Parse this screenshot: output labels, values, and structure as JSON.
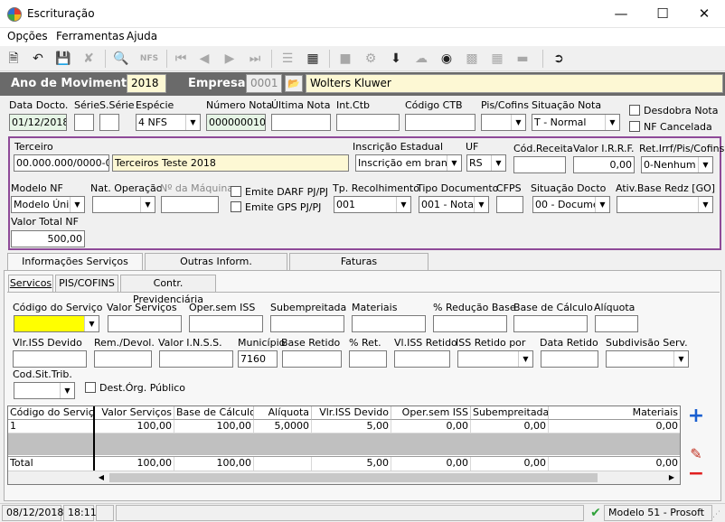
{
  "window": {
    "title": "Escrituração"
  },
  "menu": [
    "Opções",
    "Ferramentas",
    "Ajuda"
  ],
  "toolbar": {
    "nfs_label": "NFS"
  },
  "header": {
    "ano_label": "Ano de Movimento",
    "ano_value": "2018",
    "empresa_label": "Empresa",
    "empresa_code": "0001",
    "empresa_name": "Wolters Kluwer"
  },
  "doc": {
    "data_docto_label": "Data Docto.",
    "data_docto": "01/12/2018",
    "serie_label": "Série",
    "serie": "",
    "sserie_label": "S.Série",
    "sserie": "",
    "especie_label": "Espécie",
    "especie": "4 NFS",
    "numero_label": "Número Nota",
    "numero": "0000000100",
    "ultima_label": "Última Nota",
    "ultima": "",
    "intctb_label": "Int.Ctb",
    "intctb": "",
    "codctb_label": "Código CTB",
    "codctb": "",
    "piscofins_label": "Pis/Cofins",
    "piscofins": "",
    "situacao_label": "Situação Nota",
    "situacao": "T - Normal",
    "desdobra_label": "Desdobra Nota",
    "cancelada_label": "NF Cancelada"
  },
  "terceiro": {
    "label": "Terceiro",
    "cnpj": "00.000.000/0000-00",
    "nome": "Terceiros Teste 2018",
    "ie_label": "Inscrição Estadual",
    "ie": "Inscrição em branco",
    "uf_label": "UF",
    "uf": "RS",
    "codreceita_label": "Cód.Receita",
    "codreceita": "",
    "irrf_label": "Valor I.R.R.F.",
    "irrf": "0,00",
    "retirrf_label": "Ret.Irrf/Pis/Cofins",
    "retirrf": "0-Nenhum",
    "modelo_label": "Modelo NF",
    "modelo": "Modelo Únic",
    "natop_label": "Nat. Operação",
    "natop": "",
    "maquina_label": "Nº da Máquina",
    "maquina": "",
    "darf_label": "Emite DARF PJ/PJ",
    "gps_label": "Emite GPS PJ/PJ",
    "tprecol_label": "Tp. Recolhimento",
    "tprecol": "001",
    "tipodoc_label": "Tipo Documento",
    "tipodoc": "001 - Nota F",
    "cfps_label": "CFPS",
    "cfps": "",
    "sitdocto_label": "Situação Docto",
    "sitdocto": "00 - Documen",
    "ativbase_label": "Ativ.Base Redz [GO]",
    "ativbase": "",
    "vtotal_label": "Valor Total NF",
    "vtotal": "500,00"
  },
  "tabs_main": [
    "Informações Serviços",
    "Outras Inform.",
    "Faturas"
  ],
  "tabs_sub": [
    "Servicos",
    "PIS/COFINS",
    "Contr. Previdenciária"
  ],
  "serv": {
    "codserv_label": "Código do Serviço",
    "codserv": "",
    "valserv_label": "Valor Serviços",
    "valserv": "",
    "opersem_label": "Oper.sem ISS",
    "opersem": "",
    "subemp_label": "Subempreitada",
    "subemp": "",
    "materiais_label": "Materiais",
    "materiais": "",
    "redbase_label": "% Redução Base",
    "redbase": "",
    "basecalc_label": "Base de Cálculo",
    "basecalc": "",
    "aliquota_label": "Alíquota",
    "aliquota": "",
    "vliss_label": "Vlr.ISS Devido",
    "vliss": "",
    "remdev_label": "Rem./Devol.",
    "remdev": "",
    "inss_label": "Valor I.N.S.S.",
    "inss": "",
    "municipio_label": "Município",
    "municipio": "7160",
    "baseret_label": "Base Retido",
    "baseret": "",
    "pret_label": "% Ret.",
    "pret": "",
    "vlissret_label": "Vl.ISS Retido",
    "vlissret": "",
    "issretpor_label": "ISS Retido por",
    "issretpor": "",
    "dataret_label": "Data Retido",
    "dataret": "",
    "subdiv_label": "Subdivisão Serv.",
    "subdiv": "",
    "codsit_label": "Cod.Sit.Trib.",
    "codsit": "",
    "destorg_label": "Dest.Órg. Público"
  },
  "grid": {
    "columns": [
      "Código do Serviço",
      "Valor Serviços",
      "Base de Cálculo",
      "Alíquota",
      "Vlr.ISS Devido",
      "Oper.sem ISS",
      "Subempreitada",
      "Materiais"
    ],
    "row": [
      "1",
      "100,00",
      "100,00",
      "5,0000",
      "5,00",
      "0,00",
      "0,00",
      "0,00"
    ],
    "total": [
      "Total",
      "100,00",
      "100,00",
      "",
      "5,00",
      "0,00",
      "0,00",
      "0,00"
    ]
  },
  "status": {
    "date": "08/12/2018",
    "time": "18:11",
    "model": "Modelo 51 - Prosoft"
  }
}
